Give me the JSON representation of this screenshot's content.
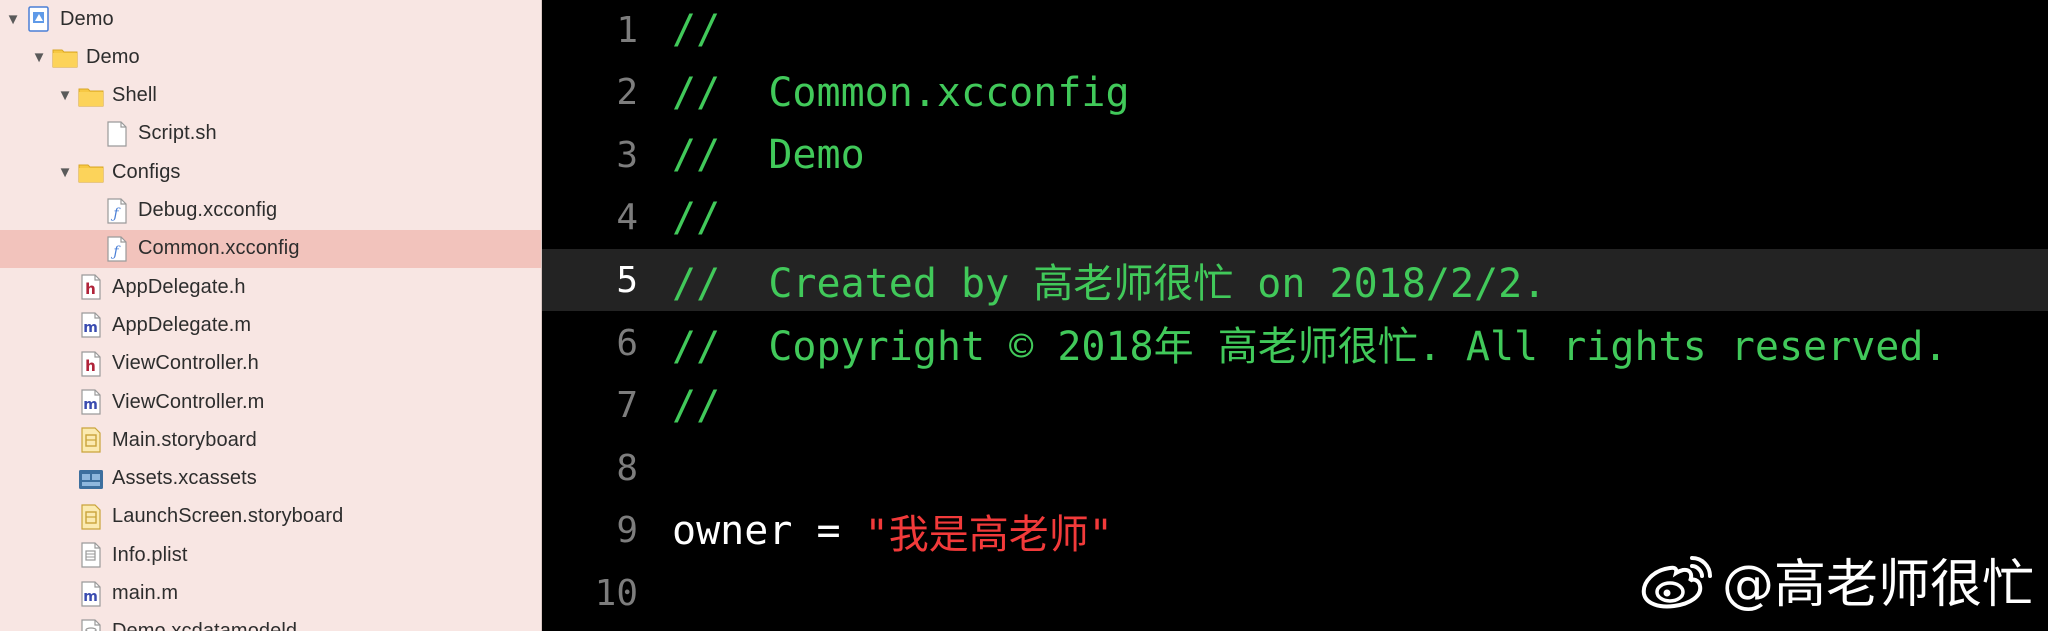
{
  "navigator": {
    "items": [
      {
        "label": "Demo",
        "icon": "project-icon",
        "disclosure": "▼",
        "depth": 0
      },
      {
        "label": "Demo",
        "icon": "folder-icon",
        "disclosure": "▼",
        "depth": 1
      },
      {
        "label": "Shell",
        "icon": "folder-icon",
        "disclosure": "▼",
        "depth": 2
      },
      {
        "label": "Script.sh",
        "icon": "file-icon",
        "disclosure": "",
        "depth": 3
      },
      {
        "label": "Configs",
        "icon": "folder-icon",
        "disclosure": "▼",
        "depth": 2
      },
      {
        "label": "Debug.xcconfig",
        "icon": "xcconfig-file-icon",
        "disclosure": "",
        "depth": 3
      },
      {
        "label": "Common.xcconfig",
        "icon": "xcconfig-file-icon",
        "disclosure": "",
        "depth": 3,
        "selected": true
      },
      {
        "label": "AppDelegate.h",
        "icon": "header-file-icon",
        "icon_letter": "h",
        "disclosure": "",
        "depth": 2
      },
      {
        "label": "AppDelegate.m",
        "icon": "implementation-file-icon",
        "icon_letter": "m",
        "disclosure": "",
        "depth": 2
      },
      {
        "label": "ViewController.h",
        "icon": "header-file-icon",
        "icon_letter": "h",
        "disclosure": "",
        "depth": 2
      },
      {
        "label": "ViewController.m",
        "icon": "implementation-file-icon",
        "icon_letter": "m",
        "disclosure": "",
        "depth": 2
      },
      {
        "label": "Main.storyboard",
        "icon": "storyboard-file-icon",
        "disclosure": "",
        "depth": 2
      },
      {
        "label": "Assets.xcassets",
        "icon": "asset-catalog-icon",
        "disclosure": "",
        "depth": 2
      },
      {
        "label": "LaunchScreen.storyboard",
        "icon": "storyboard-file-icon",
        "disclosure": "",
        "depth": 2
      },
      {
        "label": "Info.plist",
        "icon": "plist-file-icon",
        "disclosure": "",
        "depth": 2
      },
      {
        "label": "main.m",
        "icon": "implementation-file-icon",
        "icon_letter": "m",
        "disclosure": "",
        "depth": 2
      },
      {
        "label": "Demo.xcdatamodeld",
        "icon": "data-model-icon",
        "disclosure": "",
        "depth": 2
      }
    ]
  },
  "editor": {
    "current_line": 5,
    "lines": [
      {
        "number": "1",
        "tokens": [
          {
            "type": "comment",
            "text": "//"
          }
        ]
      },
      {
        "number": "2",
        "tokens": [
          {
            "type": "comment",
            "text": "//  Common.xcconfig"
          }
        ]
      },
      {
        "number": "3",
        "tokens": [
          {
            "type": "comment",
            "text": "//  Demo"
          }
        ]
      },
      {
        "number": "4",
        "tokens": [
          {
            "type": "comment",
            "text": "//"
          }
        ]
      },
      {
        "number": "5",
        "tokens": [
          {
            "type": "comment",
            "text": "//  Created by 高老师很忙 on 2018/2/2."
          }
        ]
      },
      {
        "number": "6",
        "tokens": [
          {
            "type": "comment",
            "text": "//  Copyright © 2018年 高老师很忙. All rights reserved."
          }
        ]
      },
      {
        "number": "7",
        "tokens": [
          {
            "type": "comment",
            "text": "//"
          }
        ]
      },
      {
        "number": "8",
        "tokens": []
      },
      {
        "number": "9",
        "tokens": [
          {
            "type": "plain",
            "text": "owner = "
          },
          {
            "type": "string",
            "text": "\"我是高老师\""
          }
        ]
      },
      {
        "number": "10",
        "tokens": []
      }
    ]
  },
  "watermark": {
    "icon": "weibo-logo-icon",
    "text": "@高老师很忙"
  },
  "colors": {
    "comment": "#41c95a",
    "string": "#f23a3a",
    "plain": "#ffffff",
    "selection": "#f2c3bc",
    "navigator_bg": "#f8e6e3"
  }
}
